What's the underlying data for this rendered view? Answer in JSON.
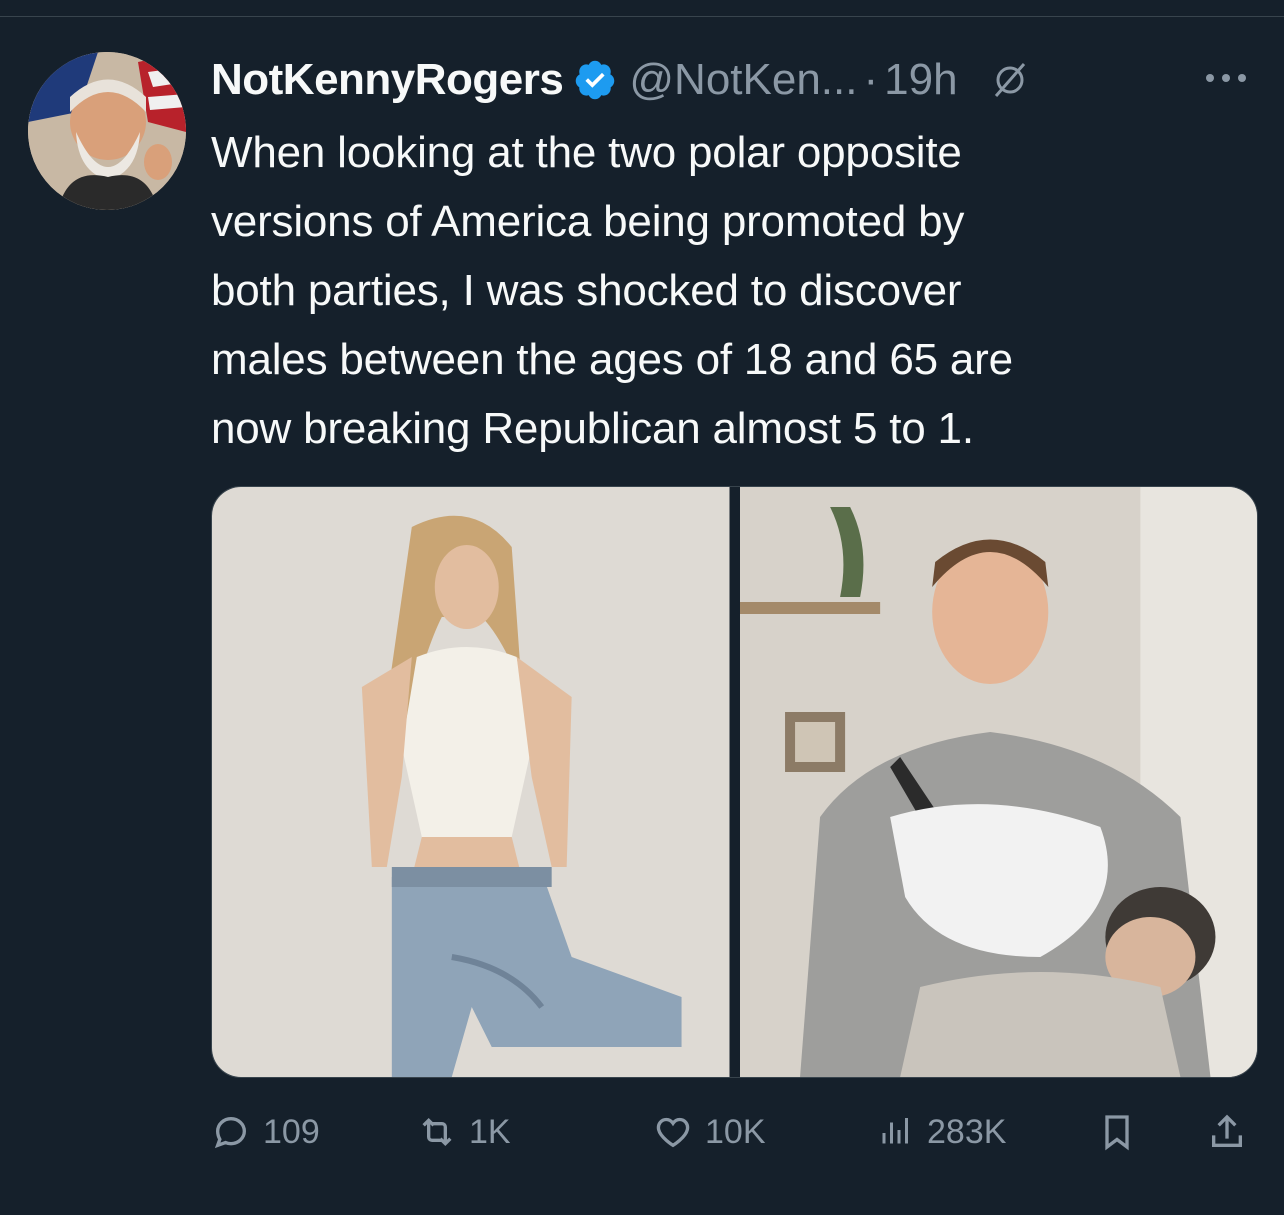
{
  "tweet": {
    "display_name": "NotKennyRogers",
    "handle": "@NotKen...",
    "dot": "·",
    "time": "19h",
    "text_lines": [
      "When looking at the two polar opposite",
      "versions of America being promoted by",
      "both parties, I was shocked to discover",
      "males between the ages of 18 and 65 are",
      "now breaking Republican almost 5 to 1."
    ]
  },
  "actions": {
    "replies": "109",
    "reposts": "1K",
    "likes": "10K",
    "views": "283K"
  },
  "icons": {
    "verified": "verified-badge-icon",
    "grok": "grok-icon",
    "more": "more-icon",
    "reply": "reply-icon",
    "repost": "repost-icon",
    "like": "heart-icon",
    "views": "views-chart-icon",
    "bookmark": "bookmark-icon",
    "share": "share-icon"
  },
  "colors": {
    "background": "#15202b",
    "text": "#f7f9f9",
    "secondary": "#8b98a5",
    "verified": "#1d9bf0"
  }
}
